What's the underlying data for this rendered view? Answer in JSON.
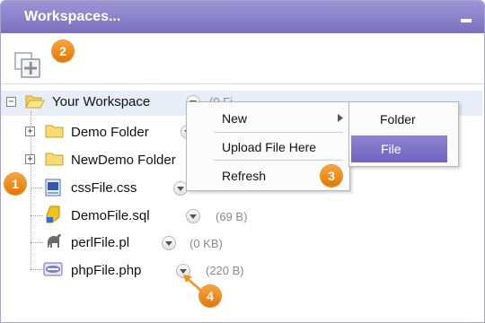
{
  "panel": {
    "title": "Workspaces...",
    "minimize_label": "minimize"
  },
  "badges": [
    "1",
    "2",
    "3",
    "4"
  ],
  "tree": {
    "root": {
      "label": "Your Workspace",
      "size": "(0 Fi"
    },
    "folders": [
      {
        "label": "Demo Folder"
      },
      {
        "label": "NewDemo Folder"
      }
    ],
    "files": [
      {
        "label": "cssFile.css",
        "size": "",
        "icon": "css-file-icon"
      },
      {
        "label": "DemoFile.sql",
        "size": "(69 B)",
        "icon": "sql-file-icon"
      },
      {
        "label": "perlFile.pl",
        "size": "(0 KB)",
        "icon": "perl-file-icon"
      },
      {
        "label": "phpFile.php",
        "size": "(220 B)",
        "icon": "php-file-icon"
      }
    ]
  },
  "context_menu": {
    "items": {
      "new": "New",
      "upload": "Upload File Here",
      "refresh": "Refresh"
    },
    "submenu": {
      "folder": "Folder",
      "file": "File"
    }
  },
  "colors": {
    "titlebar": "#8a82cb",
    "accent": "#f39325",
    "selection": "#e8eef8",
    "submenu_highlight": "#7a70c4"
  }
}
